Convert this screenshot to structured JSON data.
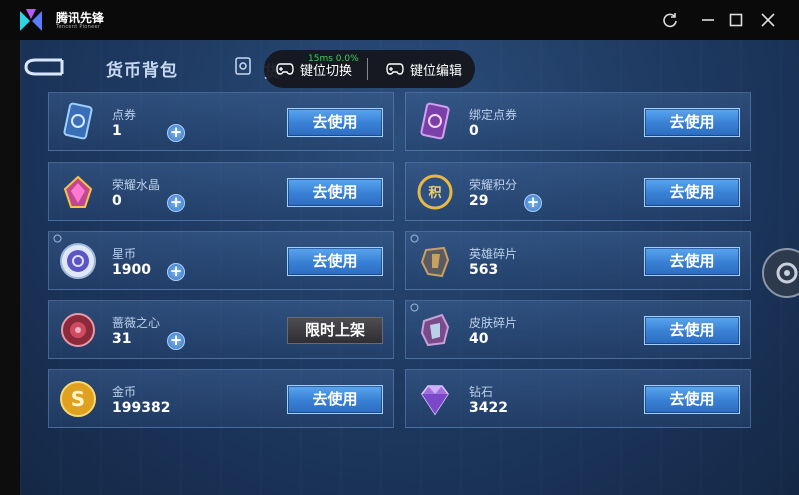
{
  "app": {
    "title": "腾讯先锋",
    "subtitle": "Tencent Pioneer"
  },
  "window_controls": [
    "refresh-icon",
    "minimize-icon",
    "maximize-icon",
    "close-icon"
  ],
  "game": {
    "page_title": "货币背包",
    "tab2_partial": "货",
    "overlay": {
      "fps_text": "15ms  0.0%",
      "key_switch": "键位切换",
      "key_edit": "键位编辑"
    },
    "use_label": "去使用",
    "items": [
      {
        "name": "点券",
        "count": "1",
        "icon": "coupon-card-icon",
        "plus": true,
        "button": "use"
      },
      {
        "name": "绑定点券",
        "count": "0",
        "icon": "bound-coupon-card-icon",
        "plus": false,
        "button": "use"
      },
      {
        "name": "荣耀水晶",
        "count": "0",
        "icon": "glory-crystal-icon",
        "plus": true,
        "button": "use"
      },
      {
        "name": "荣耀积分",
        "count": "29",
        "icon": "glory-points-icon",
        "plus": true,
        "button": "use"
      },
      {
        "name": "星币",
        "count": "1900",
        "icon": "star-coin-icon",
        "plus": true,
        "button": "use"
      },
      {
        "name": "英雄碎片",
        "count": "563",
        "icon": "hero-fragment-icon",
        "plus": false,
        "button": "use"
      },
      {
        "name": "蔷薇之心",
        "count": "31",
        "icon": "rose-heart-icon",
        "plus": true,
        "button": "limited"
      },
      {
        "name": "皮肤碎片",
        "count": "40",
        "icon": "skin-fragment-icon",
        "plus": false,
        "button": "use"
      },
      {
        "name": "金币",
        "count": "199382",
        "icon": "gold-coin-icon",
        "plus": false,
        "button": "use"
      },
      {
        "name": "钻石",
        "count": "3422",
        "icon": "diamond-icon",
        "plus": false,
        "button": "use"
      }
    ],
    "limited_label": "限时上架",
    "colors": {
      "button_blue": "#3a82d6",
      "fps_green": "#3ad15a",
      "background": "#213f68"
    }
  }
}
